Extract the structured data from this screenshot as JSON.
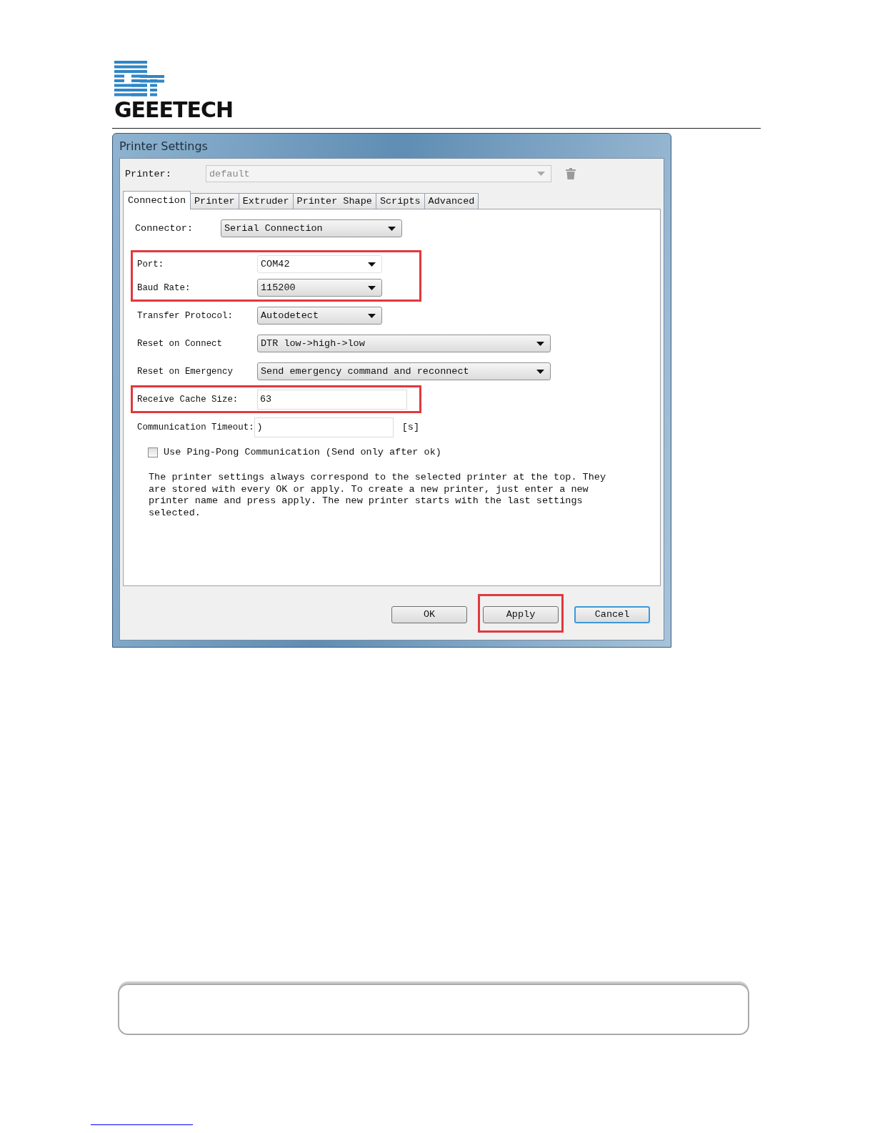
{
  "page_header": {
    "logo_text": "GEEETECH"
  },
  "dialog": {
    "title": "Printer Settings",
    "printer": {
      "label": "Printer:",
      "value": "default",
      "disabled": true
    },
    "tabs": [
      {
        "label": "Connection",
        "selected": true
      },
      {
        "label": "Printer",
        "selected": false
      },
      {
        "label": "Extruder",
        "selected": false
      },
      {
        "label": "Printer Shape",
        "selected": false
      },
      {
        "label": "Scripts",
        "selected": false
      },
      {
        "label": "Advanced",
        "selected": false
      }
    ],
    "connector": {
      "label": "Connector:",
      "value": "Serial Connection"
    },
    "fields": [
      {
        "kind": "dropdown",
        "label": "Port:",
        "value": "COM42",
        "highlighted": true
      },
      {
        "kind": "dropdown",
        "label": "Baud Rate:",
        "value": "115200",
        "highlighted": true
      },
      {
        "kind": "dropdown",
        "label": "Transfer Protocol:",
        "value": "Autodetect",
        "highlighted": false
      },
      {
        "kind": "widedropdown",
        "label": "Reset on Connect",
        "value": "DTR low->high->low",
        "highlighted": false
      },
      {
        "kind": "widedropdown",
        "label": "Reset on Emergency",
        "value": "Send emergency command and reconnect",
        "highlighted": false
      },
      {
        "kind": "text",
        "label": "Receive Cache Size:",
        "value": "63",
        "highlighted": true
      },
      {
        "kind": "text",
        "label": "Communication Timeout:",
        "value": ")",
        "unit": "[s]",
        "highlighted": false
      }
    ],
    "ping_pong": {
      "label": "Use Ping-Pong Communication (Send only after ok)",
      "checked": false
    },
    "note": "The printer settings always correspond to the selected printer at the top. They are stored with every OK or apply. To create a new printer, just enter a new printer name and press apply. The new printer starts with the last settings selected.",
    "buttons": [
      {
        "label": "OK",
        "highlighted": false,
        "focused": false
      },
      {
        "label": "Apply",
        "highlighted": true,
        "focused": false
      },
      {
        "label": "Cancel",
        "highlighted": false,
        "focused": true
      }
    ]
  }
}
